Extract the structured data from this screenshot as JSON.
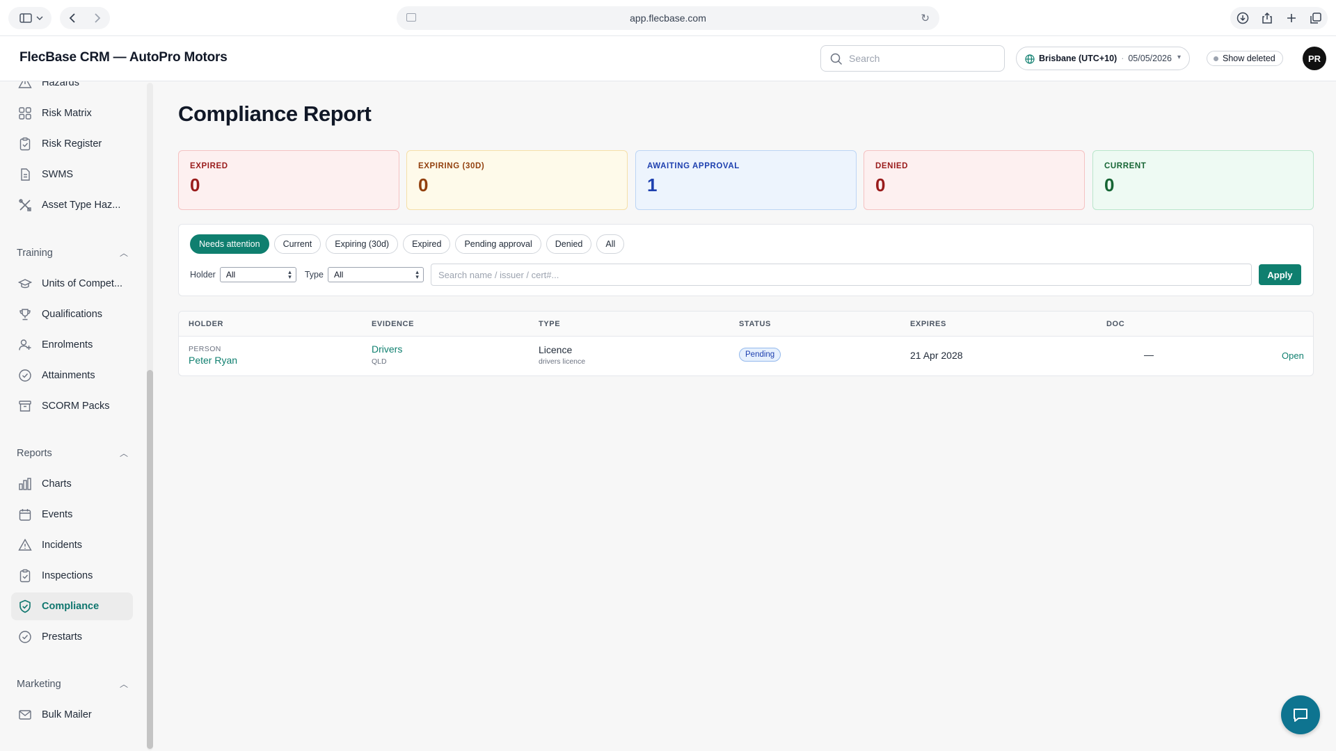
{
  "browser": {
    "url": "app.flecbase.com"
  },
  "header": {
    "title": "FlecBase CRM — AutoPro Motors",
    "search_placeholder": "Search",
    "timezone": "Brisbane (UTC+10)",
    "date": "05/05/2026",
    "show_deleted": "Show deleted",
    "avatar_initials": "PR"
  },
  "sidebar": {
    "items_top": [
      {
        "label": "Hazards",
        "icon": "warning-icon"
      },
      {
        "label": "Risk Matrix",
        "icon": "grid-icon"
      },
      {
        "label": "Risk Register",
        "icon": "clipboard-check-icon"
      },
      {
        "label": "SWMS",
        "icon": "document-icon"
      },
      {
        "label": "Asset Type Haz...",
        "icon": "tools-icon"
      }
    ],
    "sections": [
      {
        "title": "Training",
        "items": [
          {
            "label": "Units of Compet...",
            "icon": "graduation-cap-icon"
          },
          {
            "label": "Qualifications",
            "icon": "trophy-icon"
          },
          {
            "label": "Enrolments",
            "icon": "user-plus-icon"
          },
          {
            "label": "Attainments",
            "icon": "check-circle-icon"
          },
          {
            "label": "SCORM Packs",
            "icon": "archive-icon"
          }
        ]
      },
      {
        "title": "Reports",
        "items": [
          {
            "label": "Charts",
            "icon": "bar-chart-icon"
          },
          {
            "label": "Events",
            "icon": "calendar-icon"
          },
          {
            "label": "Incidents",
            "icon": "warning-icon"
          },
          {
            "label": "Inspections",
            "icon": "clipboard-check-icon"
          },
          {
            "label": "Compliance",
            "icon": "shield-check-icon"
          },
          {
            "label": "Prestarts",
            "icon": "check-circle-icon"
          }
        ]
      },
      {
        "title": "Marketing",
        "items": [
          {
            "label": "Bulk Mailer",
            "icon": "mail-icon"
          }
        ]
      }
    ],
    "active": "Compliance"
  },
  "main": {
    "title": "Compliance Report",
    "stats": [
      {
        "label": "EXPIRED",
        "value": "0"
      },
      {
        "label": "EXPIRING (30D)",
        "value": "0"
      },
      {
        "label": "AWAITING APPROVAL",
        "value": "1"
      },
      {
        "label": "DENIED",
        "value": "0"
      },
      {
        "label": "CURRENT",
        "value": "0"
      }
    ],
    "chips": [
      "Needs attention",
      "Current",
      "Expiring (30d)",
      "Expired",
      "Pending approval",
      "Denied",
      "All"
    ],
    "active_chip": "Needs attention",
    "filters": {
      "holder_label": "Holder",
      "holder_value": "All",
      "type_label": "Type",
      "type_value": "All",
      "search_placeholder": "Search name / issuer / cert#...",
      "apply_label": "Apply"
    },
    "table": {
      "columns": [
        "HOLDER",
        "EVIDENCE",
        "TYPE",
        "STATUS",
        "EXPIRES",
        "DOC"
      ],
      "rows": [
        {
          "holder_kind": "PERSON",
          "holder_name": "Peter Ryan",
          "evidence": "Drivers",
          "evidence_sub": "QLD",
          "type": "Licence",
          "type_sub": "drivers licence",
          "status": "Pending",
          "expires": "21 Apr 2028",
          "doc": "—",
          "action": "Open"
        }
      ]
    }
  },
  "colors": {
    "accent": "#0f7f6f",
    "fab": "#0e7490"
  }
}
